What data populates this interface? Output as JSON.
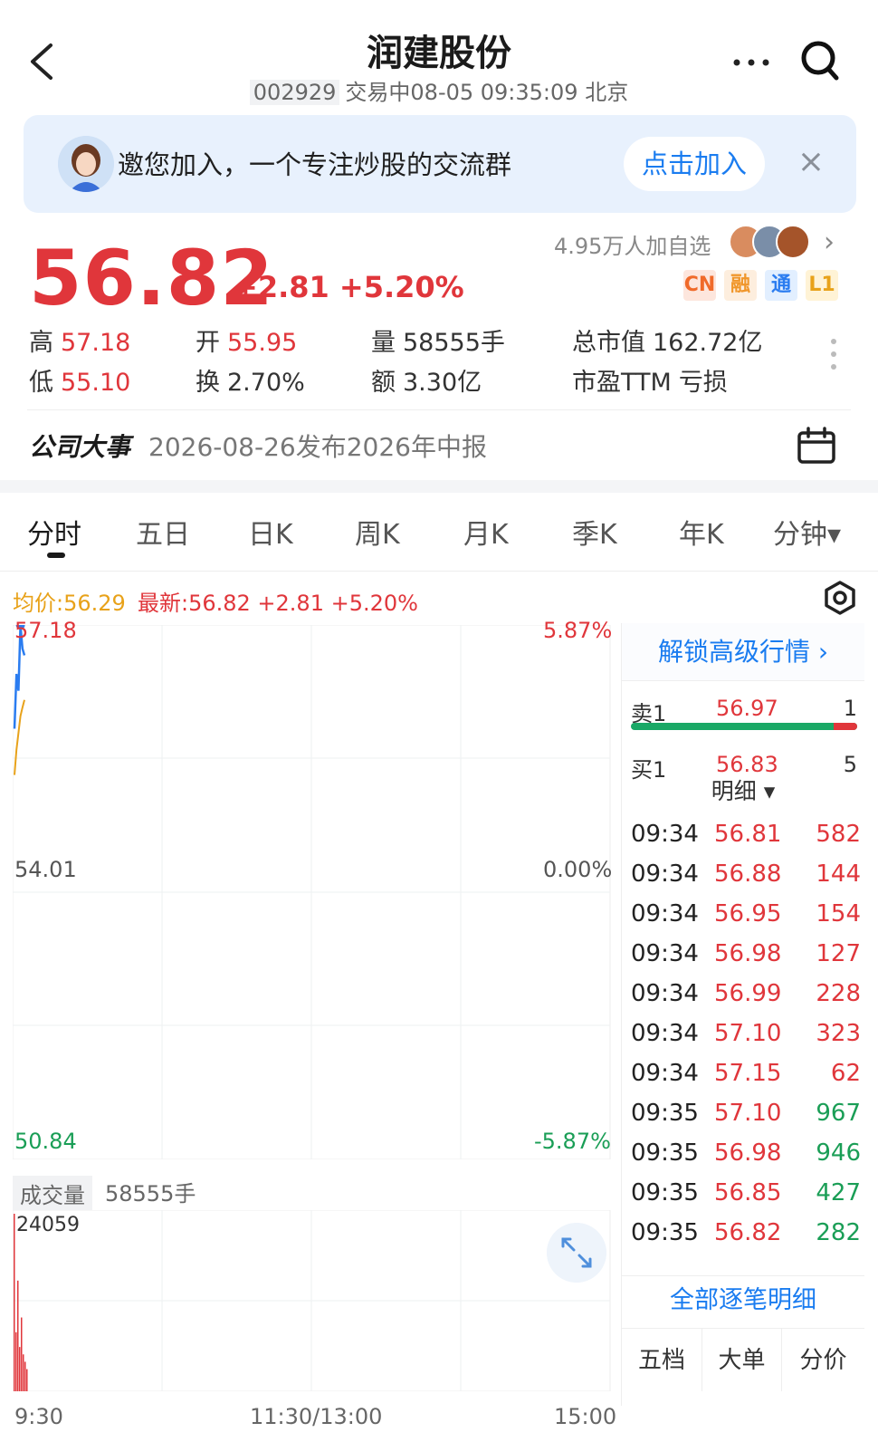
{
  "header": {
    "title": "润建股份",
    "code": "002929",
    "status": "交易中08-05 09:35:09 北京"
  },
  "banner": {
    "text": "邀您加入，一个专注炒股的交流群",
    "join_label": "点击加入",
    "close_glyph": "×"
  },
  "quote": {
    "price": "56.82",
    "change": "+2.81",
    "change_pct": "+5.20%",
    "followers": "4.95万人加自选",
    "badges": [
      "CN",
      "融",
      "通",
      "L1"
    ],
    "stats": {
      "high_label": "高",
      "high": "57.18",
      "low_label": "低",
      "low": "55.10",
      "open_label": "开",
      "open": "55.95",
      "turnover_label": "换",
      "turnover": "2.70%",
      "volume_label": "量",
      "volume": "58555手",
      "amount_label": "额",
      "amount": "3.30亿",
      "mktcap_label": "总市值",
      "mktcap": "162.72亿",
      "pe_label": "市盈TTM",
      "pe": "亏损"
    }
  },
  "event": {
    "label": "公司大事",
    "text": "2026-08-26发布2026年中报"
  },
  "tabs": [
    "分时",
    "五日",
    "日K",
    "周K",
    "月K",
    "季K",
    "年K",
    "分钟▾"
  ],
  "chart_header": {
    "avg": "均价:56.29",
    "latest": "最新:56.82  +2.81  +5.20%"
  },
  "chart": {
    "y_top": "57.18",
    "y_mid": "54.01",
    "y_bottom": "50.84",
    "pct_top": "5.87%",
    "pct_mid": "0.00%",
    "pct_bottom": "-5.87%",
    "volume_label": "成交量",
    "volume_value": "58555手",
    "volume_max": "24059",
    "x_start": "9:30",
    "x_mid": "11:30/13:00",
    "x_end": "15:00"
  },
  "chart_data": {
    "type": "line",
    "ylim": [
      50.84,
      57.18
    ],
    "series": [
      {
        "values": [
          55.95,
          56.6,
          56.4,
          57.18,
          56.9,
          56.82
        ]
      },
      {
        "values": [
          55.4,
          55.7,
          55.9,
          56.1,
          56.2,
          56.29
        ]
      }
    ],
    "volume_ylim": [
      0,
      24059
    ],
    "volume_values": [
      24059,
      8000,
      15000,
      6000,
      10000,
      5000,
      4000,
      3000
    ]
  },
  "panel": {
    "unlock": "解锁高级行情 ›",
    "sell1_label": "卖1",
    "sell1_price": "56.97",
    "sell1_vol": "1",
    "buy1_label": "买1",
    "buy1_price": "56.83",
    "buy1_vol": "5",
    "detail_label": "明细 ▾",
    "trades": [
      {
        "time": "09:34",
        "price": "56.81",
        "vol": "582",
        "dir": "sell"
      },
      {
        "time": "09:34",
        "price": "56.88",
        "vol": "144",
        "dir": "sell"
      },
      {
        "time": "09:34",
        "price": "56.95",
        "vol": "154",
        "dir": "sell"
      },
      {
        "time": "09:34",
        "price": "56.98",
        "vol": "127",
        "dir": "sell"
      },
      {
        "time": "09:34",
        "price": "56.99",
        "vol": "228",
        "dir": "sell"
      },
      {
        "time": "09:34",
        "price": "57.10",
        "vol": "323",
        "dir": "sell"
      },
      {
        "time": "09:34",
        "price": "57.15",
        "vol": "62",
        "dir": "sell"
      },
      {
        "time": "09:35",
        "price": "57.10",
        "vol": "967",
        "dir": "buy"
      },
      {
        "time": "09:35",
        "price": "56.98",
        "vol": "946",
        "dir": "buy"
      },
      {
        "time": "09:35",
        "price": "56.85",
        "vol": "427",
        "dir": "buy"
      },
      {
        "time": "09:35",
        "price": "56.82",
        "vol": "282",
        "dir": "buy"
      }
    ],
    "all_trades": "全部逐笔明细",
    "bottom_tabs": [
      "五档",
      "大单",
      "分价"
    ]
  },
  "colors": {
    "up": "#e0363b",
    "down": "#1a9e56",
    "accent": "#1a7cf0",
    "avg_line": "#e8a21a",
    "price_line": "#2a7cf0"
  }
}
